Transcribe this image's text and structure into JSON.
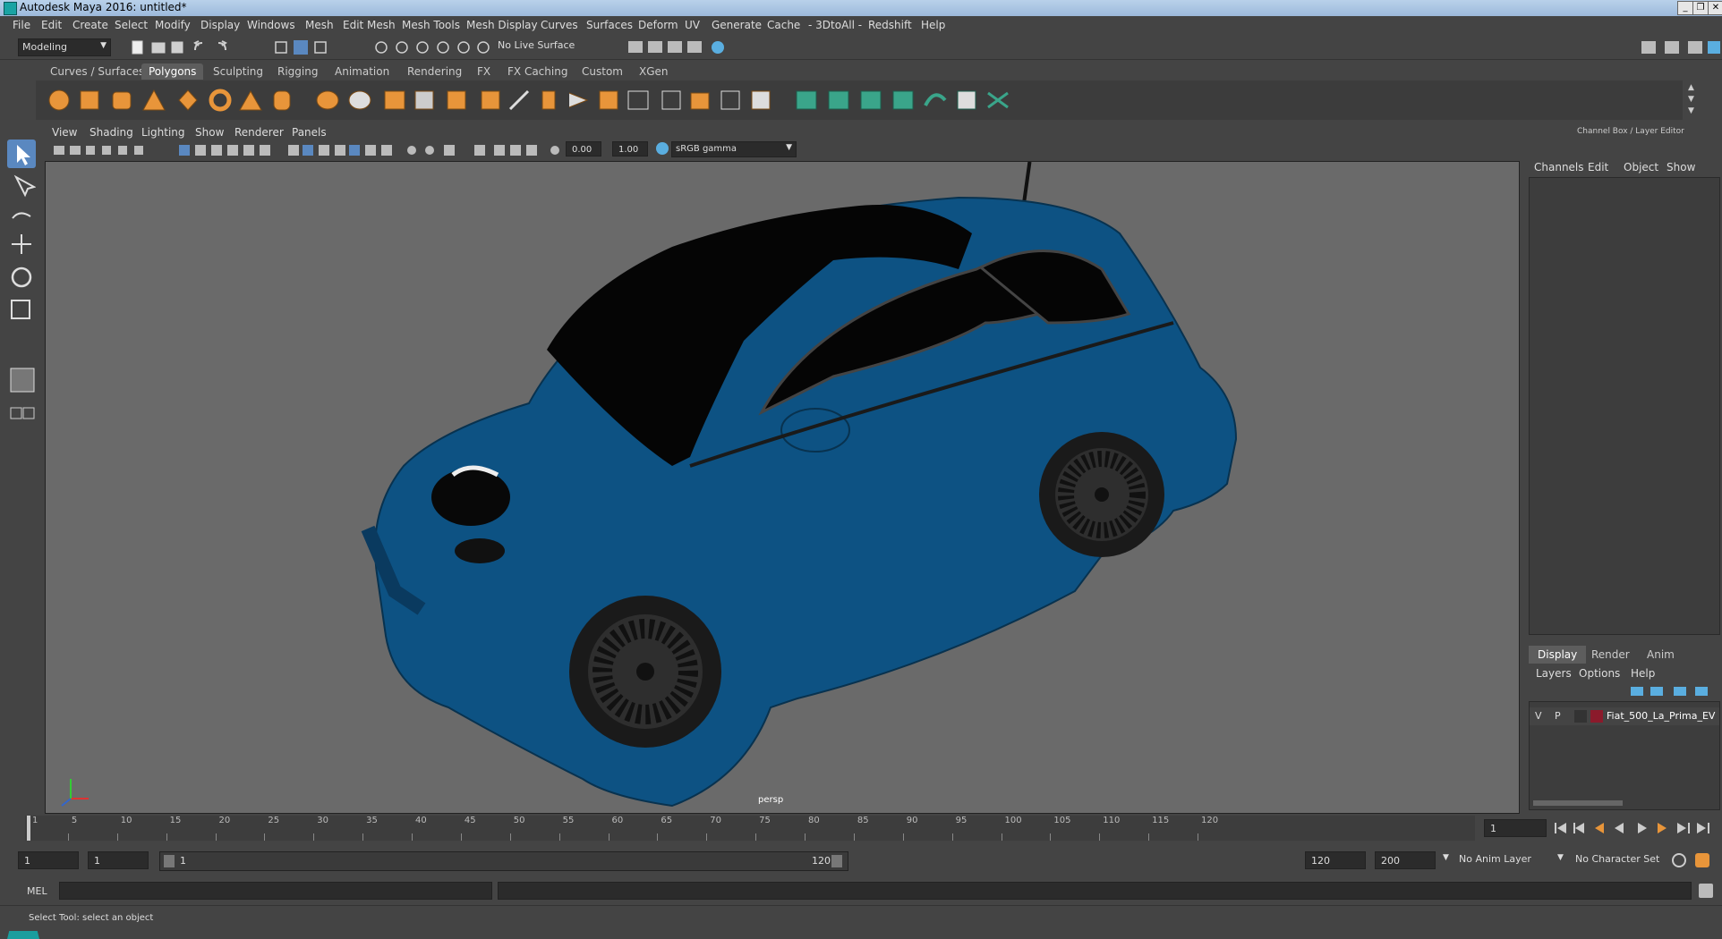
{
  "title_bar": {
    "title": "Autodesk Maya 2016: untitled*"
  },
  "menu": [
    "File",
    "Edit",
    "Create",
    "Select",
    "Modify",
    "Display",
    "Windows",
    "Mesh",
    "Edit Mesh",
    "Mesh Tools",
    "Mesh Display",
    "Curves",
    "Surfaces",
    "Deform",
    "UV",
    "Generate",
    "Cache",
    "- 3DtoAll -",
    "Redshift",
    "Help"
  ],
  "status_line": {
    "mode": "Modeling",
    "live_surface": "No Live Surface"
  },
  "shelf_tabs": [
    "Curves / Surfaces",
    "Polygons",
    "Sculpting",
    "Rigging",
    "Animation",
    "Rendering",
    "FX",
    "FX Caching",
    "Custom",
    "XGen"
  ],
  "shelf_active": "Polygons",
  "viewport": {
    "menu": [
      "View",
      "Shading",
      "Lighting",
      "Show",
      "Renderer",
      "Panels"
    ],
    "field_a": "0.00",
    "field_b": "1.00",
    "color_space": "sRGB gamma",
    "camera_label": "persp"
  },
  "right_panel": {
    "title": "Channel Box / Layer Editor",
    "channel_menu": [
      "Channels",
      "Edit",
      "Object",
      "Show"
    ],
    "tabs": [
      "Display",
      "Render",
      "Anim"
    ],
    "active_tab": "Display",
    "layer_menu": [
      "Layers",
      "Options",
      "Help"
    ],
    "layer": {
      "v": "V",
      "p": "P",
      "name": "Fiat_500_La_Prima_EV",
      "color": "#8b1a2b"
    }
  },
  "timeline": {
    "ticks": [
      "1",
      "5",
      "10",
      "15",
      "20",
      "25",
      "30",
      "35",
      "40",
      "45",
      "50",
      "55",
      "60",
      "65",
      "70",
      "75",
      "80",
      "85",
      "90",
      "95",
      "100",
      "105",
      "110",
      "115",
      "120"
    ],
    "current_frame": "1"
  },
  "range": {
    "start": "1",
    "playback_start": "1",
    "slider_start": "1",
    "slider_end": "120",
    "playback_end": "120",
    "end": "200",
    "anim_layer": "No Anim Layer",
    "character_set": "No Character Set"
  },
  "command_line": {
    "label": "MEL"
  },
  "help_line": {
    "text": "Select Tool: select an object"
  },
  "colors": {
    "car_body": "#0d5283",
    "window_tint": "#050505",
    "taillight": "#c0202a"
  }
}
